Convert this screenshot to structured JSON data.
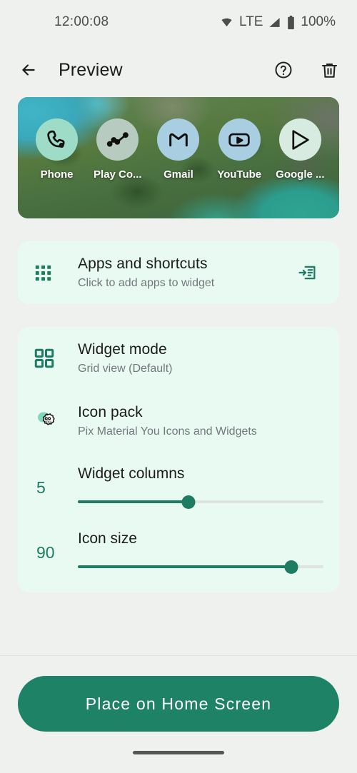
{
  "statusbar": {
    "time": "12:00:08",
    "network": "LTE",
    "battery": "100%",
    "wifi_icon": "wifi-icon",
    "signal_icon": "signal-icon",
    "battery_icon": "battery-icon"
  },
  "appbar": {
    "back_icon": "back-arrow-icon",
    "title": "Preview",
    "help_icon": "help-circle-icon",
    "delete_icon": "trash-icon"
  },
  "preview": {
    "apps": [
      {
        "label": "Phone",
        "icon": "phone-icon",
        "circle": "#9fdcc8"
      },
      {
        "label": "Play Co...",
        "icon": "play-console-icon",
        "circle": "#b7cbc0"
      },
      {
        "label": "Gmail",
        "icon": "gmail-icon",
        "circle": "#a9cee1"
      },
      {
        "label": "YouTube",
        "icon": "youtube-icon",
        "circle": "#a9cde1"
      },
      {
        "label": "Google ...",
        "icon": "google-play-icon",
        "circle": "#d8ebe1"
      }
    ]
  },
  "apps_card": {
    "lead_icon": "apps-grid-icon",
    "title": "Apps and shortcuts",
    "subtitle": "Click to add apps to widget",
    "trail_icon": "add-to-widget-icon"
  },
  "settings_card": {
    "widget_mode": {
      "lead_icon": "widget-grid-icon",
      "title": "Widget mode",
      "subtitle": "Grid view (Default)"
    },
    "icon_pack": {
      "lead_icon": "icon-pack-badge-icon",
      "title": "Icon pack",
      "subtitle": "Pix Material You Icons and Widgets"
    },
    "widget_columns": {
      "value": "5",
      "label": "Widget columns",
      "percent": 45
    },
    "icon_size": {
      "value": "90",
      "label": "Icon size",
      "percent": 87
    }
  },
  "footer": {
    "cta_label": "Place on Home Screen"
  },
  "colors": {
    "accent": "#1d8266",
    "accent_dark": "#1d7d63",
    "card_bg": "#e9faf3",
    "page_bg": "#eef1ee",
    "title_text": "#1b1c1b",
    "sub_text": "#71787a"
  }
}
